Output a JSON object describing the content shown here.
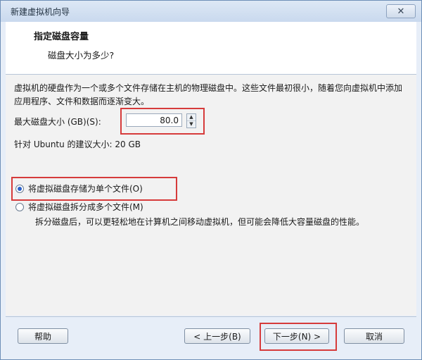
{
  "window": {
    "title": "新建虚拟机向导",
    "close_label": "✕"
  },
  "header": {
    "title": "指定磁盘容量",
    "subtitle": "磁盘大小为多少?"
  },
  "body": {
    "description": "虚拟机的硬盘作为一个或多个文件存储在主机的物理磁盘中。这些文件最初很小，随着您向虚拟机中添加应用程序、文件和数据而逐渐变大。",
    "size_label": "最大磁盘大小 (GB)(S):",
    "size_value": "80.0",
    "suggestion": "针对 Ubuntu 的建议大小: 20 GB",
    "option_single": "将虚拟磁盘存储为单个文件(O)",
    "option_split": "将虚拟磁盘拆分成多个文件(M)",
    "split_note": "拆分磁盘后，可以更轻松地在计算机之间移动虚拟机，但可能会降低大容量磁盘的性能。",
    "selected_option": "single"
  },
  "footer": {
    "help": "帮助",
    "back": "< 上一步(B)",
    "next": "下一步(N) >",
    "cancel": "取消"
  },
  "colors": {
    "highlight": "#d63b3b",
    "radio_selected": "#2b61c9"
  }
}
